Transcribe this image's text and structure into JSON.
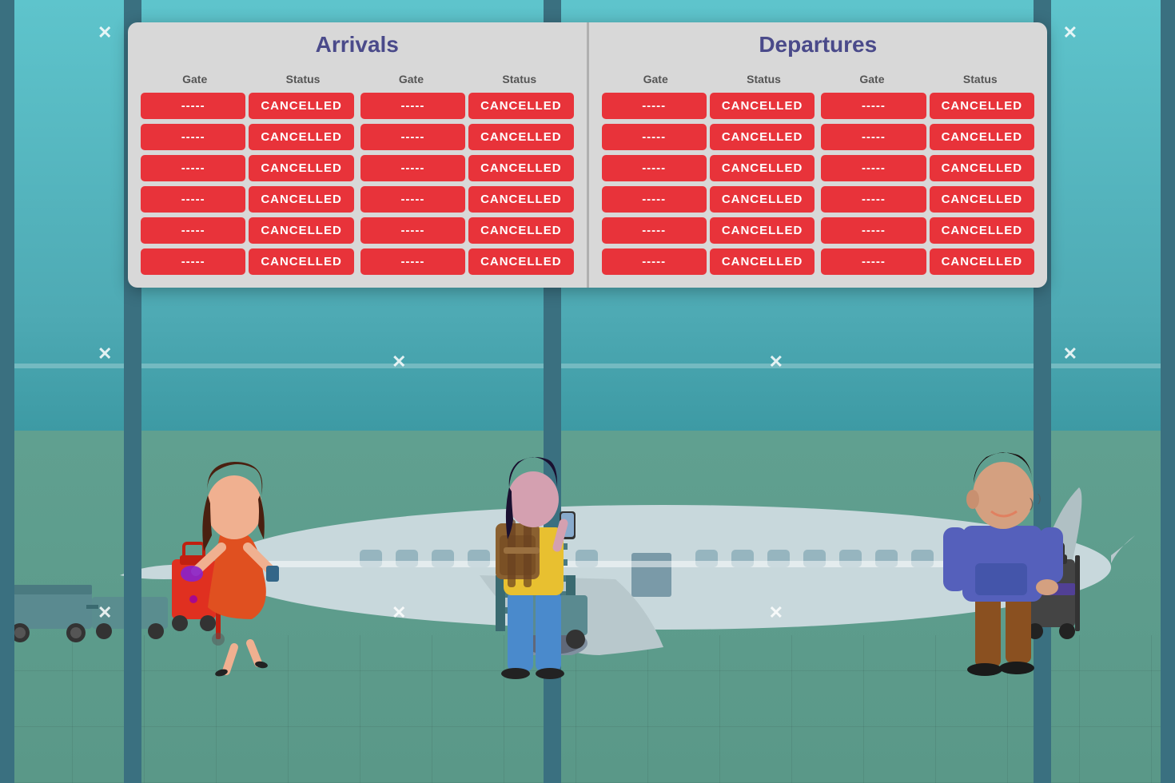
{
  "arrivals": {
    "title": "Arrivals",
    "columns": [
      {
        "gate_header": "Gate",
        "status_header": "Status"
      },
      {
        "gate_header": "Gate",
        "status_header": "Status"
      }
    ],
    "rows_col1": [
      {
        "gate": "-----",
        "status": "CANCELLED"
      },
      {
        "gate": "-----",
        "status": "CANCELLED"
      },
      {
        "gate": "-----",
        "status": "CANCELLED"
      },
      {
        "gate": "-----",
        "status": "CANCELLED"
      },
      {
        "gate": "-----",
        "status": "CANCELLED"
      },
      {
        "gate": "-----",
        "status": "CANCELLED"
      }
    ],
    "rows_col2": [
      {
        "gate": "-----",
        "status": "CANCELLED"
      },
      {
        "gate": "-----",
        "status": "CANCELLED"
      },
      {
        "gate": "-----",
        "status": "CANCELLED"
      },
      {
        "gate": "-----",
        "status": "CANCELLED"
      },
      {
        "gate": "-----",
        "status": "CANCELLED"
      },
      {
        "gate": "-----",
        "status": "CANCELLED"
      }
    ]
  },
  "departures": {
    "title": "Departures",
    "columns": [
      {
        "gate_header": "Gate",
        "status_header": "Status"
      },
      {
        "gate_header": "Gate",
        "status_header": "Status"
      }
    ],
    "rows_col1": [
      {
        "gate": "-----",
        "status": "CANCELLED"
      },
      {
        "gate": "-----",
        "status": "CANCELLED"
      },
      {
        "gate": "-----",
        "status": "CANCELLED"
      },
      {
        "gate": "-----",
        "status": "CANCELLED"
      },
      {
        "gate": "-----",
        "status": "CANCELLED"
      },
      {
        "gate": "-----",
        "status": "CANCELLED"
      }
    ],
    "rows_col2": [
      {
        "gate": "-----",
        "status": "CANCELLED"
      },
      {
        "gate": "-----",
        "status": "CANCELLED"
      },
      {
        "gate": "-----",
        "status": "CANCELLED"
      },
      {
        "gate": "-----",
        "status": "CANCELLED"
      },
      {
        "gate": "-----",
        "status": "CANCELLED"
      },
      {
        "gate": "-----",
        "status": "CANCELLED"
      }
    ]
  },
  "colors": {
    "cancelled_bg": "#e8333a",
    "cancelled_text": "#ffffff",
    "board_bg": "#d8d8d8",
    "title_color": "#4a4a8a",
    "header_color": "#555555"
  },
  "cross_icon": "✕",
  "gate_placeholder": "-----",
  "status_cancelled": "CANCELLED"
}
